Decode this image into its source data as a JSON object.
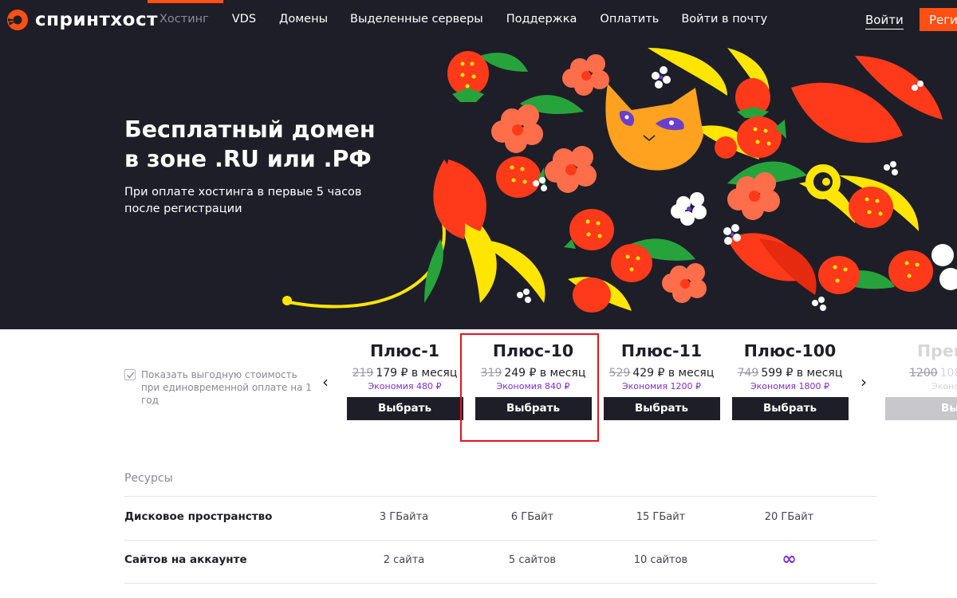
{
  "brand": {
    "name": "спринтхост",
    "accent": "#ff4f12"
  },
  "nav": {
    "items": [
      "Хостинг",
      "VDS",
      "Домены",
      "Выделенные серверы",
      "Поддержка",
      "Оплатить",
      "Войти в почту"
    ],
    "active": "Хостинг",
    "login": "Войти",
    "register": "Регис"
  },
  "hero": {
    "title": "Бесплатный домен в зоне .RU или .РФ",
    "subtitle": "При оплате хостинга в первые 5 часов после регистрации"
  },
  "pricing": {
    "checkbox_checked": true,
    "checkbox_label": "Показать выгодную стоимость при единовременной оплате на 1 год",
    "prev_arrow": "‹",
    "next_arrow": "›",
    "plans": [
      {
        "name": "Плюс-1",
        "old_price": "219",
        "price": "179 ₽ в месяц",
        "saving": "Экономия 480 ₽",
        "button": "Выбрать"
      },
      {
        "name": "Плюс-10",
        "old_price": "319",
        "price": "249 ₽ в месяц",
        "saving": "Экономия 840 ₽",
        "button": "Выбрать"
      },
      {
        "name": "Плюс-11",
        "old_price": "529",
        "price": "429 ₽ в месяц",
        "saving": "Экономия 1200 ₽",
        "button": "Выбрать"
      },
      {
        "name": "Плюс-100",
        "old_price": "749",
        "price": "599 ₽ в месяц",
        "saving": "Экономия 1800 ₽",
        "button": "Выбрать"
      },
      {
        "name": "Прем",
        "old_price": "1200",
        "price": "108",
        "saving": "Эконо",
        "button": "Вы"
      }
    ]
  },
  "resources": {
    "title": "Ресурсы",
    "rows": [
      {
        "label": "Дисковое пространство",
        "values": [
          "3 ГБайта",
          "6 ГБайт",
          "15 ГБайт",
          "20 ГБайт"
        ]
      },
      {
        "label": "Сайтов на аккаунте",
        "values": [
          "2 сайта",
          "5 сайтов",
          "10 сайтов",
          "∞"
        ]
      }
    ]
  }
}
